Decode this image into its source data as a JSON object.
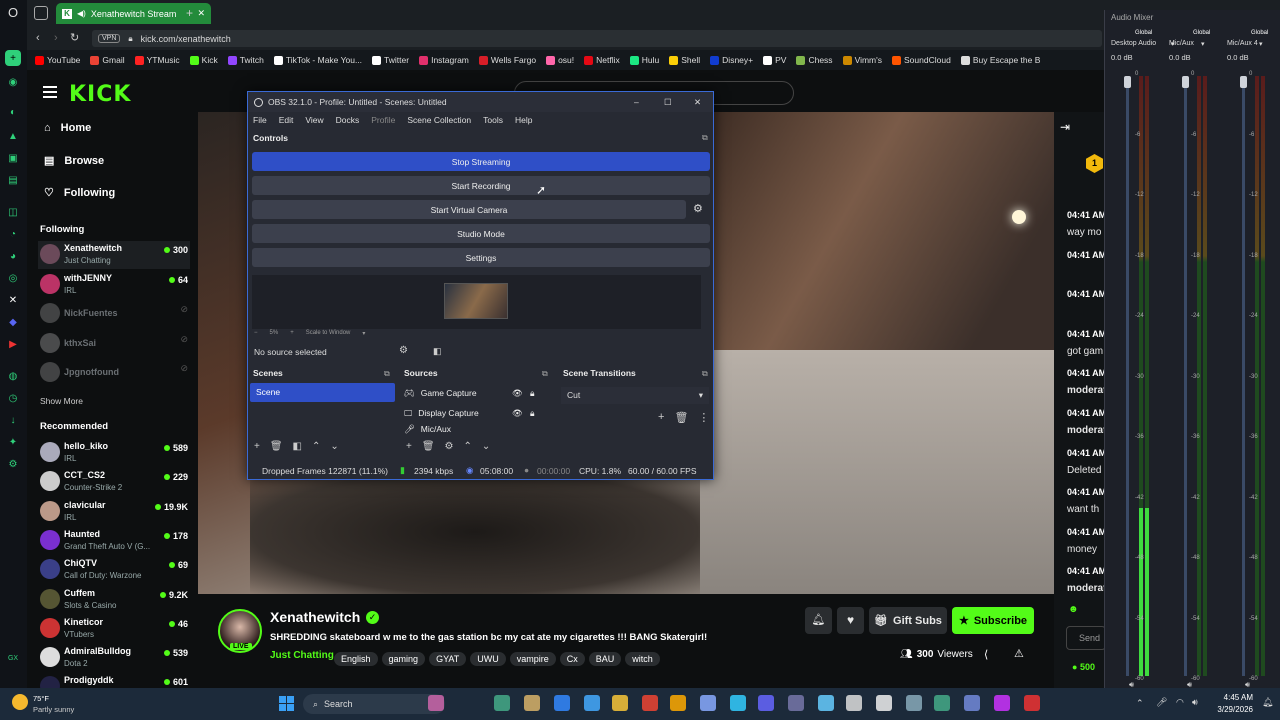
{
  "browser": {
    "tab_title": "Xenathewitch Stream",
    "vpn_label": "VPN",
    "url": "kick.com/xenathewitch",
    "bookmarks": [
      "YouTube",
      "Gmail",
      "YTMusic",
      "Kick",
      "Twitch",
      "TikTok - Make You...",
      "Twitter",
      "Instagram",
      "Wells Fargo",
      "osu!",
      "Netflix",
      "Hulu",
      "Shell",
      "Disney+",
      "PV",
      "Chess",
      "Vimm's",
      "SoundCloud",
      "Buy Escape the B"
    ]
  },
  "kick": {
    "logo": "KICK",
    "nav": {
      "home": "Home",
      "browse": "Browse",
      "following": "Following"
    },
    "following_title": "Following",
    "following": [
      {
        "name": "Xenathewitch",
        "category": "Just Chatting",
        "viewers": "300",
        "live": true
      },
      {
        "name": "withJENNY",
        "category": "IRL",
        "viewers": "64",
        "live": true
      },
      {
        "name": "NickFuentes",
        "category": "",
        "viewers": "",
        "live": false
      },
      {
        "name": "kthxSai",
        "category": "",
        "viewers": "",
        "live": false
      },
      {
        "name": "Jpgnotfound",
        "category": "",
        "viewers": "",
        "live": false
      }
    ],
    "show_more": "Show More",
    "recommended_title": "Recommended",
    "recommended": [
      {
        "name": "hello_kiko",
        "category": "IRL",
        "viewers": "589"
      },
      {
        "name": "CCT_CS2",
        "category": "Counter-Strike 2",
        "viewers": "229"
      },
      {
        "name": "clavicular",
        "category": "IRL",
        "viewers": "19.9K"
      },
      {
        "name": "Haunted",
        "category": "Grand Theft Auto V (G...",
        "viewers": "178"
      },
      {
        "name": "ChiQTV",
        "category": "Call of Duty: Warzone",
        "viewers": "69"
      },
      {
        "name": "Cuffem",
        "category": "Slots & Casino",
        "viewers": "9.2K"
      },
      {
        "name": "Kineticor",
        "category": "VTubers",
        "viewers": "46"
      },
      {
        "name": "AdmiralBulldog",
        "category": "Dota 2",
        "viewers": "539"
      },
      {
        "name": "Prodigyddk",
        "category": "",
        "viewers": "601"
      }
    ],
    "stream": {
      "streamer": "Xenathewitch",
      "live_badge": "LIVE",
      "title": "SHREDDING skateboard w me to the gas station bc my cat ate my cigarettes !!! BANG Skatergirl!",
      "category": "Just Chatting",
      "tags": [
        "English",
        "gaming",
        "GYAT",
        "UWU",
        "vampire",
        "Cx",
        "BAU",
        "witch"
      ],
      "viewers": "300",
      "viewers_label": "Viewers",
      "gift_subs": "Gift Subs",
      "subscribe": "Subscribe"
    },
    "chat": {
      "badge": "1",
      "messages": [
        {
          "time": "04:41 AM",
          "text": "way mo"
        },
        {
          "time": "04:41 AM",
          "text": ""
        },
        {
          "time": "04:41 AM",
          "text": ""
        },
        {
          "time": "04:41 AM",
          "text": "got gam"
        },
        {
          "time": "04:41 AM",
          "text": "moderat"
        },
        {
          "time": "04:41 AM",
          "text": "moderat"
        },
        {
          "time": "04:41 AM",
          "text": "Deleted"
        },
        {
          "time": "04:41 AM",
          "text": "want th"
        },
        {
          "time": "04:41 AM",
          "text": "money"
        },
        {
          "time": "04:41 AM",
          "text": "moderat"
        }
      ],
      "send_placeholder": "Send",
      "points": "500"
    }
  },
  "obs": {
    "title": "OBS 32.1.0 - Profile: Untitled - Scenes: Untitled",
    "menu": [
      "File",
      "Edit",
      "View",
      "Docks",
      "Profile",
      "Scene Collection",
      "Tools",
      "Help"
    ],
    "controls_title": "Controls",
    "buttons": {
      "stop_streaming": "Stop Streaming",
      "start_recording": "Start Recording",
      "start_virtual_camera": "Start Virtual Camera",
      "studio_mode": "Studio Mode",
      "settings": "Settings"
    },
    "zoom": "5%",
    "scale_label": "Scale to Window",
    "no_source": "No source selected",
    "scenes_title": "Scenes",
    "scenes": [
      "Scene"
    ],
    "sources_title": "Sources",
    "sources": [
      "Game Capture",
      "Display Capture",
      "Mic/Aux"
    ],
    "transitions_title": "Scene Transitions",
    "transition": "Cut",
    "status": {
      "dropped": "Dropped Frames 122871 (11.1%)",
      "bitrate": "2394 kbps",
      "stream_time": "05:08:00",
      "rec_time": "00:00:00",
      "cpu": "CPU: 1.8%",
      "fps": "60.00 / 60.00 FPS"
    }
  },
  "mixer": {
    "title": "Audio Mixer",
    "channels": [
      {
        "scope": "Global",
        "name": "Desktop Audio",
        "db": "0.0 dB",
        "level": 0.28
      },
      {
        "scope": "Global",
        "name": "Mic/Aux",
        "db": "0.0 dB",
        "level": 0.0
      },
      {
        "scope": "Global",
        "name": "Mic/Aux 4",
        "db": "0.0 dB",
        "level": 0.0
      }
    ],
    "scale": [
      "0",
      "-6",
      "-12",
      "-18",
      "-24",
      "-30",
      "-36",
      "-42",
      "-48",
      "-54",
      "-60"
    ]
  },
  "taskbar": {
    "weather_temp": "75°F",
    "weather_desc": "Partly sunny",
    "search": "Search",
    "time": "4:45 AM",
    "date": "3/29/2026"
  }
}
